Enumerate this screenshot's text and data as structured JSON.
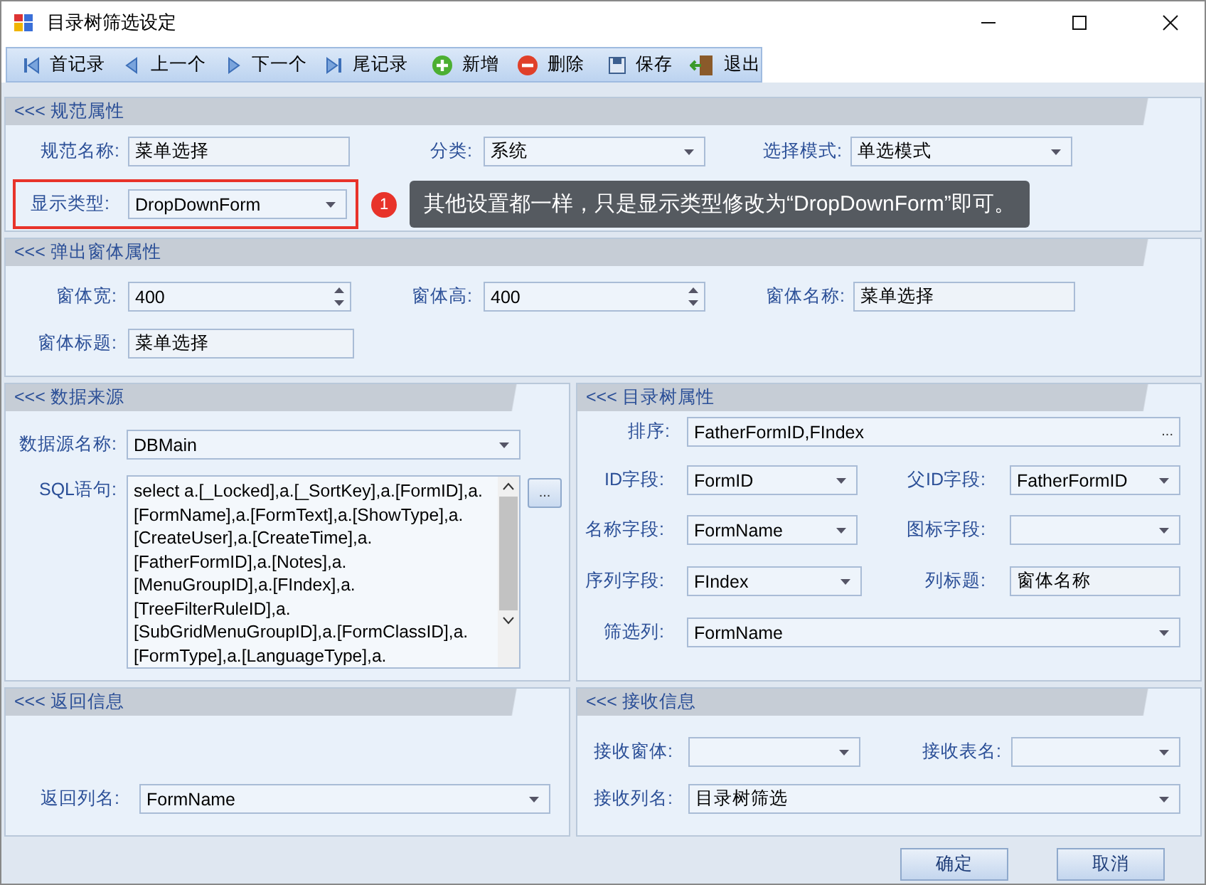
{
  "window": {
    "title": "目录树筛选设定"
  },
  "toolbar": [
    {
      "label": "首记录",
      "kind": "first"
    },
    {
      "label": "上一个",
      "kind": "prev"
    },
    {
      "label": "下一个",
      "kind": "next"
    },
    {
      "label": "尾记录",
      "kind": "last"
    },
    {
      "label": "新增",
      "kind": "add"
    },
    {
      "label": "删除",
      "kind": "delete"
    },
    {
      "label": "保存",
      "kind": "save"
    },
    {
      "label": "退出",
      "kind": "exit"
    }
  ],
  "sections": [
    {
      "title": "<<< 规范属性",
      "rows": [
        [
          {
            "label": "规范名称:",
            "value": "菜单选择",
            "kind": "text"
          },
          {
            "label": "分类:",
            "value": "系统",
            "kind": "combo"
          },
          {
            "label": "选择模式:",
            "value": "单选模式",
            "kind": "combo"
          }
        ],
        [
          {
            "label": "显示类型:",
            "value": "DropDownForm",
            "kind": "combo",
            "callout": {
              "number": "1",
              "text": "其他设置都一样，只是显示类型修改为“DropDownForm”即可。"
            }
          }
        ]
      ]
    },
    {
      "title": "<<< 弹出窗体属性",
      "rows": [
        [
          {
            "label": "窗体宽:",
            "value": "400",
            "kind": "spin"
          },
          {
            "label": "窗体高:",
            "value": "400",
            "kind": "spin"
          },
          {
            "label": "窗体名称:",
            "value": "菜单选择",
            "kind": "text"
          }
        ],
        [
          {
            "label": "窗体标题:",
            "value": "菜单选择",
            "kind": "text"
          }
        ]
      ]
    },
    {
      "title": "<<< 数据来源",
      "rows": [
        [
          {
            "label": "数据源名称:",
            "value": "DBMain",
            "kind": "combo"
          }
        ],
        [
          {
            "label": "SQL语句:",
            "value": "select a.[_Locked],a.[_SortKey],a.[FormID],a.[FormName],a.[FormText],a.[ShowType],a.[CreateUser],a.[CreateTime],a.[FatherFormID],a.[Notes],a.[MenuGroupID],a.[FIndex],a.[TreeFilterRuleID],a.[SubGridMenuGroupID],a.[FormClassID],a.[FormType],a.[LanguageType],a.",
            "kind": "memo",
            "button": "..."
          }
        ]
      ]
    },
    {
      "title": "<<< 目录树属性",
      "rows": [
        [
          {
            "label": "排序:",
            "value": "FatherFormID,FIndex",
            "kind": "lookup",
            "button": "..."
          }
        ],
        [
          {
            "label": "ID字段:",
            "value": "FormID",
            "kind": "combo"
          },
          {
            "label": "父ID字段:",
            "value": "FatherFormID",
            "kind": "combo"
          }
        ],
        [
          {
            "label": "名称字段:",
            "value": "FormName",
            "kind": "combo"
          },
          {
            "label": "图标字段:",
            "kind": "combo"
          }
        ],
        [
          {
            "label": "序列字段:",
            "value": "FIndex",
            "kind": "combo"
          },
          {
            "label": "列标题:",
            "value": "窗体名称",
            "kind": "text"
          }
        ],
        [
          {
            "label": "筛选列:",
            "value": "FormName",
            "kind": "combo"
          }
        ]
      ]
    },
    {
      "title": "<<< 返回信息",
      "rows": [
        [
          {
            "label": "返回列名:",
            "value": "FormName",
            "kind": "combo"
          }
        ]
      ]
    },
    {
      "title": "<<< 接收信息",
      "rows": [
        [
          {
            "label": "接收窗体:",
            "kind": "combo"
          },
          {
            "label": "接收表名:",
            "kind": "combo"
          }
        ],
        [
          {
            "label": "接收列名:",
            "value": "目录树筛选",
            "kind": "combo"
          }
        ]
      ]
    }
  ],
  "buttons": [
    "确定",
    "取消"
  ]
}
